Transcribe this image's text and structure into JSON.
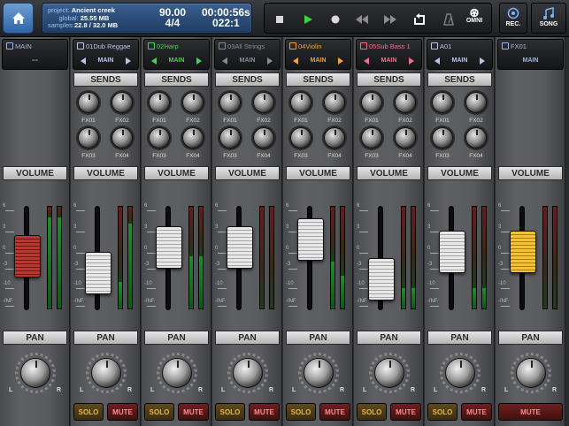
{
  "topbar": {
    "project_label": "project:",
    "project_name": "Ancient creek",
    "global_label": "global:",
    "global_value": "25.55 MB",
    "samples_label": "samples:",
    "samples_value": "22.8 / 32.0 MB",
    "tempo": "90.00",
    "signature": "4/4",
    "time": "00:00:56s",
    "bars": "022:1",
    "omni_label": "OMNI",
    "rec_label": "REC.",
    "song_label": "SONG"
  },
  "sections": {
    "sends": "SENDS",
    "volume": "VOLUME",
    "pan": "PAN"
  },
  "fx_labels": [
    "FX01",
    "FX02",
    "FX03",
    "FX04"
  ],
  "scale_labels": [
    "6",
    "3",
    "0",
    "-3",
    "-10",
    "-INF"
  ],
  "pan_labels": {
    "left": "L",
    "right": "R"
  },
  "buttons": {
    "solo": "SOLO",
    "mute": "MUTE"
  },
  "channels": [
    {
      "name": "MAIN",
      "routing": "---",
      "color": "#9db8e0",
      "fader_level": 0.52,
      "fader_color": "red",
      "meters": [
        0.88,
        0.88
      ],
      "has_sends": false,
      "has_solo": false
    },
    {
      "name": "01Dub Reggae",
      "routing": "MAIN",
      "color": "#b9c4f0",
      "fader_level": 0.36,
      "fader_color": "white",
      "meters": [
        0.26,
        0.82
      ],
      "has_sends": true,
      "has_solo": true
    },
    {
      "name": "02Harp",
      "routing": "MAIN",
      "color": "#57c95a",
      "fader_level": 0.6,
      "fader_color": "white",
      "meters": [
        0.5,
        0.5
      ],
      "has_sends": true,
      "has_solo": true
    },
    {
      "name": "03All Strings",
      "routing": "MAIN",
      "color": "#8a8a9a",
      "fader_level": 0.6,
      "fader_color": "white",
      "meters": [
        0.0,
        0.0
      ],
      "has_sends": true,
      "has_solo": true
    },
    {
      "name": "04Violin",
      "routing": "MAIN",
      "color": "#f0a03c",
      "fader_level": 0.68,
      "fader_color": "white",
      "meters": [
        0.45,
        0.32
      ],
      "has_sends": true,
      "has_solo": true
    },
    {
      "name": "05Sub Bass 1",
      "routing": "MAIN",
      "color": "#f07088",
      "fader_level": 0.3,
      "fader_color": "white",
      "meters": [
        0.2,
        0.2
      ],
      "has_sends": true,
      "has_solo": true
    },
    {
      "name": "A01",
      "routing": "MAIN",
      "color": "#b9c4f0",
      "fader_level": 0.56,
      "fader_color": "white",
      "meters": [
        0.2,
        0.2
      ],
      "has_sends": true,
      "has_solo": true
    },
    {
      "name": "FX01",
      "routing": "MAIN",
      "color": "#9db8e0",
      "fader_level": 0.56,
      "fader_color": "yellow",
      "meters": [
        0.0,
        0.0
      ],
      "has_sends": false,
      "has_solo": false
    }
  ]
}
